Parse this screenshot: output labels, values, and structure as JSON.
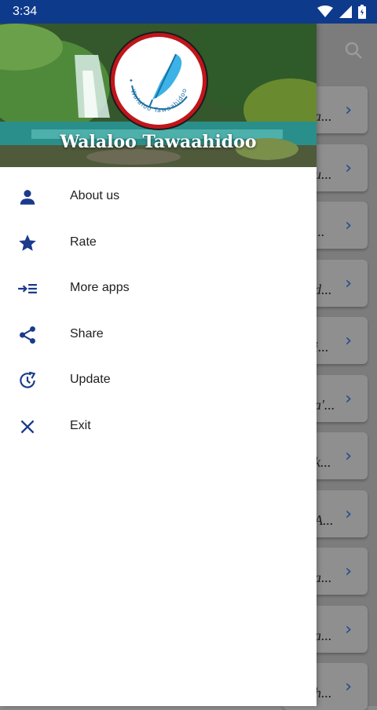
{
  "status_bar": {
    "time": "3:34"
  },
  "drawer": {
    "header": {
      "app_name": "Walaloo Tawaahidoo",
      "logo_text": "Walaloo Tawaahidoo"
    },
    "menu": [
      {
        "label": "About us",
        "icon": "person-icon"
      },
      {
        "label": "Rate",
        "icon": "star-icon"
      },
      {
        "label": "More apps",
        "icon": "more-apps-icon"
      },
      {
        "label": "Share",
        "icon": "share-icon"
      },
      {
        "label": "Update",
        "icon": "update-icon"
      },
      {
        "label": "Exit",
        "icon": "close-icon"
      }
    ]
  },
  "background_list": {
    "items": [
      {
        "snippet": "a..."
      },
      {
        "snippet": "u..."
      },
      {
        "snippet": "..."
      },
      {
        "snippet": "d..."
      },
      {
        "snippet": "i..."
      },
      {
        "snippet": "a'..."
      },
      {
        "snippet": "k..."
      },
      {
        "snippet": "A..."
      },
      {
        "snippet": "a..."
      },
      {
        "snippet": "a..."
      },
      {
        "snippet": "h..."
      }
    ]
  },
  "colors": {
    "status_bar": "#0e3a8c",
    "accent": "#1b3a8c",
    "logo_ring": "#c0161b",
    "chevron": "#1e4a8e"
  }
}
